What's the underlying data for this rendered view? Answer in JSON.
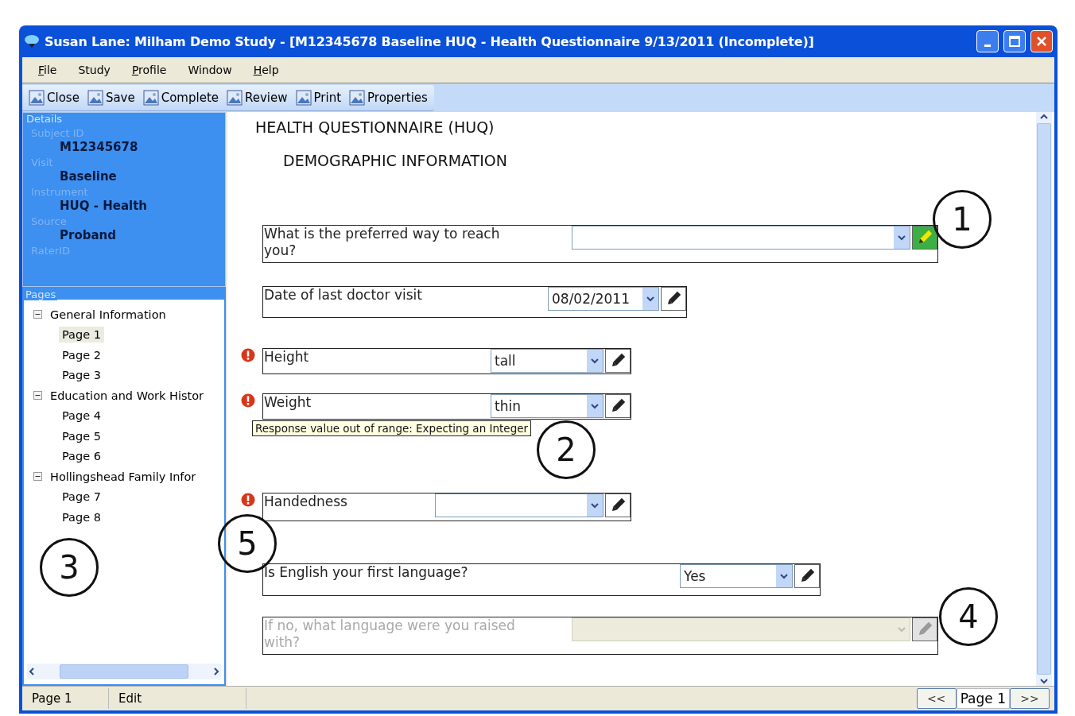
{
  "window": {
    "title": "Susan Lane: Milham Demo Study - [M12345678 Baseline HUQ - Health Questionnaire 9/13/2011 (Incomplete)]"
  },
  "menu": [
    {
      "label": "File",
      "mnemonic": true
    },
    {
      "label": "Study",
      "mnemonic": false
    },
    {
      "label": "Profile",
      "mnemonic": true
    },
    {
      "label": "Window",
      "mnemonic": false
    },
    {
      "label": "Help",
      "mnemonic": true
    }
  ],
  "toolbar": [
    "Close",
    "Save",
    "Complete",
    "Review",
    "Print",
    "Properties"
  ],
  "details": {
    "title": "Details",
    "fields": [
      {
        "label": "Subject ID",
        "value": "M12345678"
      },
      {
        "label": "Visit",
        "value": "Baseline"
      },
      {
        "label": "Instrument",
        "value": "HUQ - Health"
      },
      {
        "label": "Source",
        "value": "Proband"
      },
      {
        "label": "RaterID"
      }
    ]
  },
  "pages": {
    "title": "Pages",
    "tree": [
      {
        "label": "General Information",
        "expanded": true,
        "children": [
          {
            "label": "Page 1",
            "selected": true
          },
          {
            "label": "Page 2",
            "selected": false
          },
          {
            "label": "Page 3",
            "selected": false
          }
        ]
      },
      {
        "label": "Education and Work Histor",
        "expanded": true,
        "children": [
          {
            "label": "Page 4",
            "selected": false
          },
          {
            "label": "Page 5",
            "selected": false
          },
          {
            "label": "Page 6",
            "selected": false
          }
        ]
      },
      {
        "label": "Hollingshead Family Infor",
        "expanded": true,
        "children": [
          {
            "label": "Page 7",
            "selected": false
          },
          {
            "label": "Page 8",
            "selected": false
          }
        ]
      }
    ]
  },
  "form": {
    "title": "HEALTH QUESTIONNAIRE (HUQ)",
    "section": "DEMOGRAPHIC INFORMATION",
    "questions": [
      {
        "label": "What is the preferred way to reach you?",
        "error": false,
        "disabled": false,
        "editing": true
      },
      {
        "label": "Date of last doctor visit",
        "value": "08/02/2011",
        "error": false,
        "disabled": false,
        "editing": false
      },
      {
        "label": "Height",
        "value": "tall",
        "error": true,
        "disabled": false,
        "editing": false
      },
      {
        "label": "Weight",
        "value": "thin",
        "error": true,
        "disabled": false,
        "editing": false,
        "tooltip": "Response value out of range:  Expecting an Integer"
      },
      {
        "label": "Handedness",
        "error": true,
        "disabled": false,
        "editing": false
      },
      {
        "label": "Is English your first language?",
        "value": "Yes",
        "error": false,
        "disabled": false,
        "editing": false
      },
      {
        "label": "If no, what language were you raised with?",
        "error": false,
        "disabled": true,
        "editing": false
      }
    ]
  },
  "callouts": [
    "1",
    "2",
    "3",
    "4",
    "5"
  ],
  "status_bar": {
    "cells": [
      "Page 1",
      "Edit"
    ],
    "prev": "<<",
    "page": "Page 1",
    "next": ">>"
  }
}
